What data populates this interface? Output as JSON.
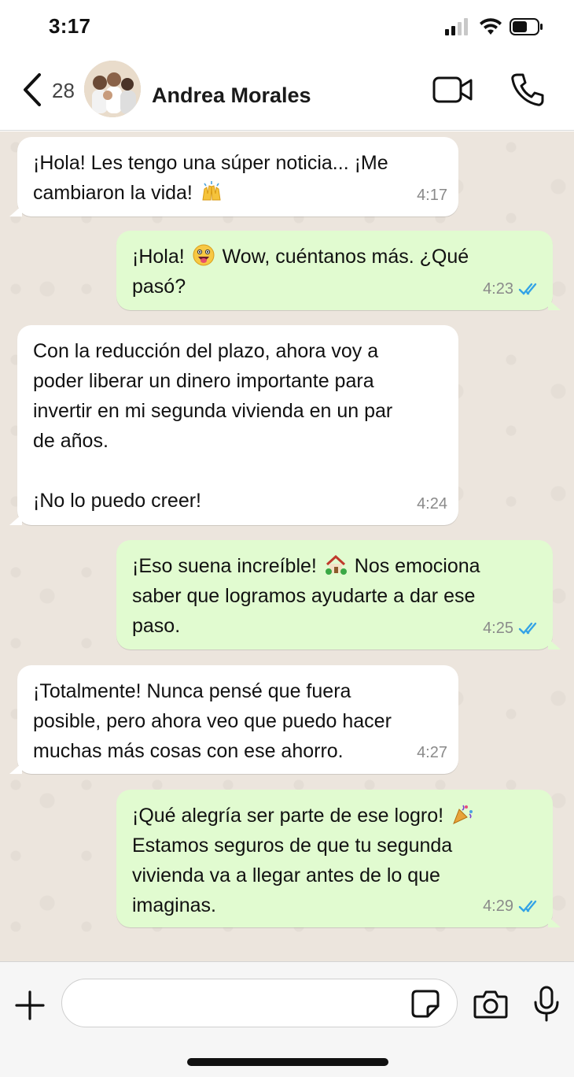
{
  "status_bar": {
    "time": "3:17",
    "icons": [
      "signal-icon",
      "wifi-icon",
      "battery-icon"
    ]
  },
  "header": {
    "back_icon": "chevron-left-icon",
    "unread_count": "28",
    "contact_name": "Andrea Morales",
    "actions": [
      "video-camera-icon",
      "phone-icon"
    ]
  },
  "messages": [
    {
      "direction": "in",
      "text": "¡Hola! Les tengo una súper noticia... ¡Me\ncambiaron la vida!",
      "emoji": "raised-hands",
      "time": "4:17"
    },
    {
      "direction": "out",
      "text_before": "¡Hola!",
      "emoji": "grinning-face-tongue",
      "text_after": "Wow, cuéntanos más. ¿Qué\npasó?",
      "time": "4:23",
      "read": true
    },
    {
      "direction": "in",
      "text": "Con la reducción del plazo, ahora voy a\npoder liberar un dinero importante para\ninvertir en mi segunda vivienda en un par\nde años.\n\n¡No lo puedo creer!",
      "time": "4:24"
    },
    {
      "direction": "out",
      "text_before": "¡Eso suena increíble!",
      "emoji": "house-with-garden",
      "text_after": "Nos emociona\nsaber que logramos ayudarte a dar ese\npaso.",
      "time": "4:25",
      "read": true
    },
    {
      "direction": "in",
      "text": "¡Totalmente! Nunca pensé que fuera\nposible, pero ahora veo que puedo hacer\nmuchas más cosas con ese ahorro.",
      "time": "4:27"
    },
    {
      "direction": "out",
      "text_before": "¡Qué alegría ser parte de ese logro!",
      "emoji": "party-popper",
      "text_after": "\nEstamos seguros de que tu segunda\nvivienda va a llegar antes de lo que\nimaginas.",
      "time": "4:29",
      "read": true
    }
  ],
  "input_bar": {
    "placeholder": "",
    "icons": [
      "plus-icon",
      "sticker-icon",
      "camera-icon",
      "microphone-icon"
    ]
  },
  "colors": {
    "incoming_bubble": "#ffffff",
    "outgoing_bubble": "#e1fbd0",
    "chat_background": "#ece5dd",
    "read_ticks": "#34a3e6"
  }
}
